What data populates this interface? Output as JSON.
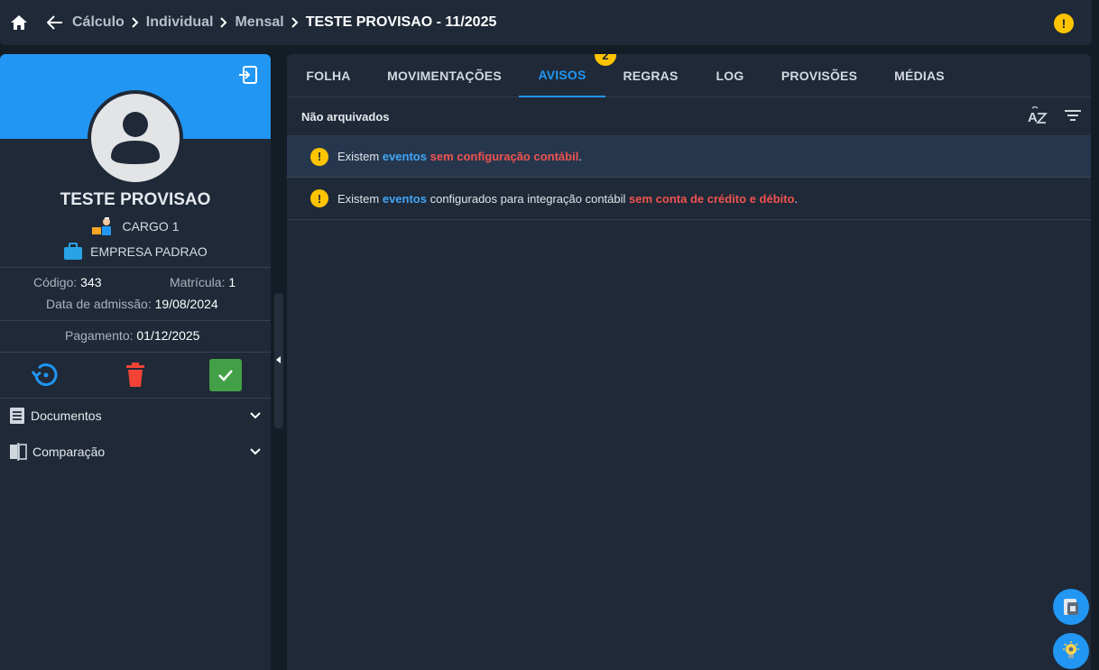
{
  "topbar": {
    "breadcrumbs": [
      "Cálculo",
      "Individual",
      "Mensal"
    ],
    "current": "TESTE PROVISAO - 11/2025",
    "alert": "!"
  },
  "profile": {
    "name": "TESTE PROVISAO",
    "cargo": "CARGO 1",
    "empresa": "EMPRESA PADRAO",
    "codigo_label": "Código: ",
    "codigo": "343",
    "matricula_label": "Matrícula: ",
    "matricula": "1",
    "admissao_label": "Data de admissão: ",
    "admissao": "19/08/2024",
    "pagamento_label": "Pagamento: ",
    "pagamento": "01/12/2025"
  },
  "sections": [
    {
      "label": "Documentos"
    },
    {
      "label": "Comparação"
    }
  ],
  "tabs": [
    {
      "label": "FOLHA"
    },
    {
      "label": "MOVIMENTAÇÕES"
    },
    {
      "label": "AVISOS",
      "badge": "2"
    },
    {
      "label": "REGRAS"
    },
    {
      "label": "LOG"
    },
    {
      "label": "PROVISÕES"
    },
    {
      "label": "MÉDIAS"
    }
  ],
  "avisos": {
    "filter_label": "Não arquivados",
    "items": [
      {
        "icon": "!",
        "p1": "Existem ",
        "link": "eventos",
        "p2": " ",
        "red": "sem configuração contábil",
        "p3": "."
      },
      {
        "icon": "!",
        "p1": "Existem ",
        "link": "eventos",
        "p2": " configurados para integração contábil ",
        "red": "sem conta de crédito e débito",
        "p3": "."
      }
    ]
  },
  "colors": {
    "accent": "#2196f3",
    "warning": "#ffc400",
    "danger": "#ef5350",
    "success": "#43a047",
    "panel": "#1f2937"
  }
}
